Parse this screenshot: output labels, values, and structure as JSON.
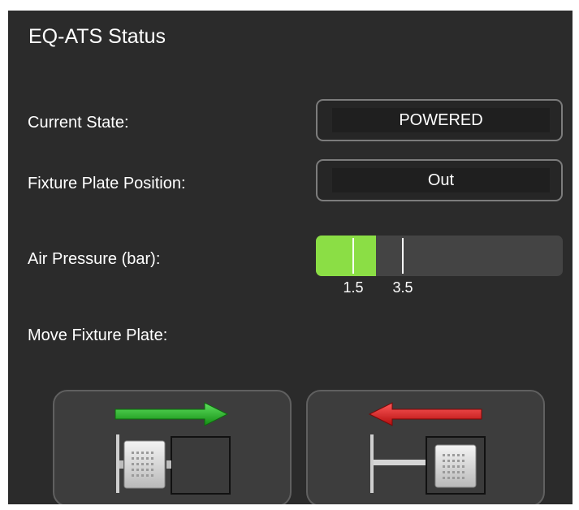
{
  "panel": {
    "title": "EQ-ATS Status"
  },
  "current_state": {
    "label": "Current State:",
    "value": "POWERED"
  },
  "fixture_plate_position": {
    "label": "Fixture Plate Position:",
    "value": "Out"
  },
  "air_pressure": {
    "label": "Air Pressure (bar):",
    "fill_fraction": 0.245,
    "min_label": "1.5",
    "max_label": "3.5",
    "fill_color": "#8bde45"
  },
  "move_fixture_plate": {
    "label": "Move Fixture Plate:",
    "move_in_icon": "right-arrow-plate-icon",
    "move_out_icon": "left-arrow-plate-icon",
    "move_in_arrow_color": "#22a822",
    "move_out_arrow_color": "#e01a1a"
  }
}
